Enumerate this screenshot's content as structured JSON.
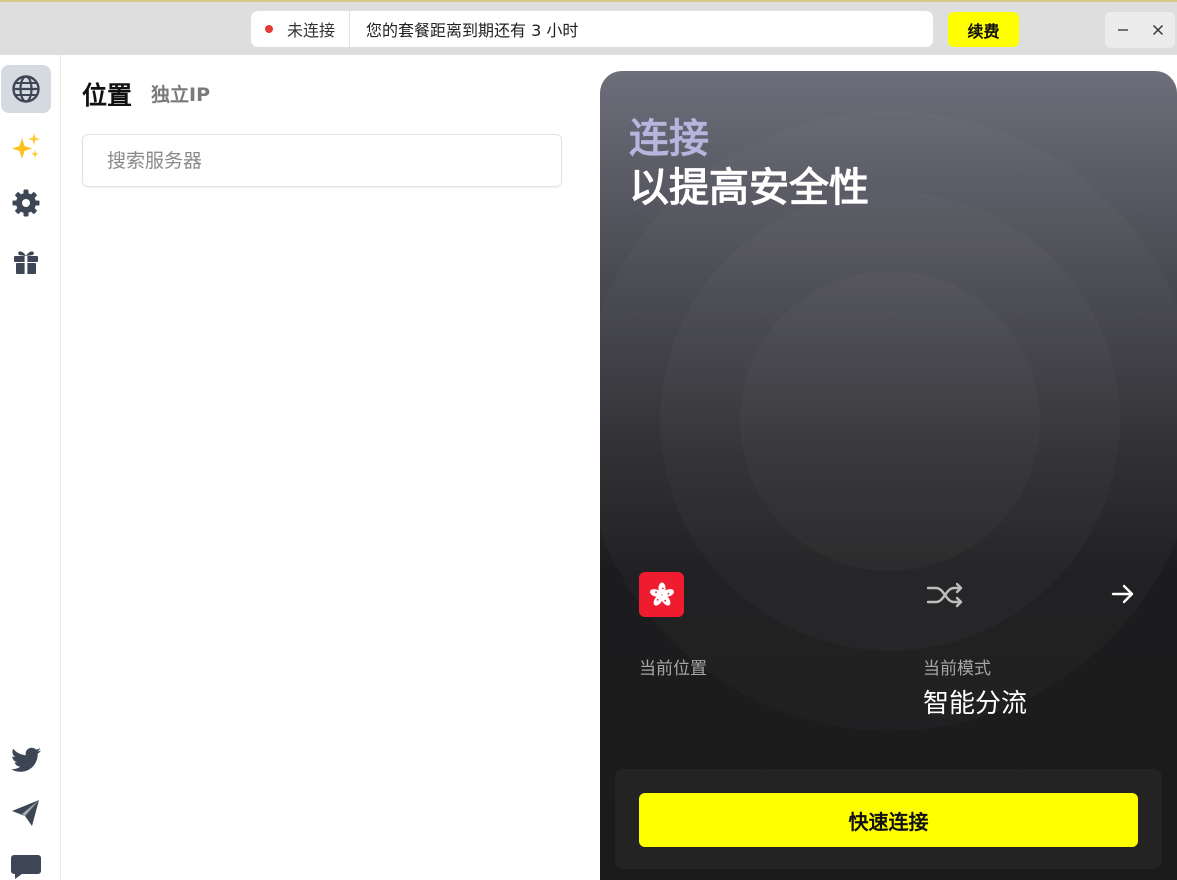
{
  "topbar": {
    "status_text": "未连接",
    "expiry_text": "您的套餐距离到期还有 3 小时",
    "renew_label": "续费",
    "status_color": "#e53935",
    "accent_color": "#ffff00",
    "minimize_symbol": "—",
    "close_symbol": "✕"
  },
  "sidebar": {
    "items": [
      {
        "icon": "globe-icon",
        "active": true
      },
      {
        "icon": "sparkles-icon",
        "active": false
      },
      {
        "icon": "gear-icon",
        "active": false
      },
      {
        "icon": "gift-icon",
        "active": false
      }
    ],
    "bottom_items": [
      {
        "icon": "twitter-icon"
      },
      {
        "icon": "telegram-icon"
      },
      {
        "icon": "chat-icon"
      }
    ]
  },
  "locations": {
    "title": "位置",
    "tab_dedicated_ip": "独立IP",
    "search_placeholder": "搜索服务器"
  },
  "connect_card": {
    "headline_line1": "连接",
    "headline_line2": "以提高安全性",
    "current_location_flag": "hong-kong-flag-icon",
    "current_location_label": "当前位置",
    "current_mode_label": "当前模式",
    "current_mode_value": "智能分流",
    "quick_connect_label": "快速连接"
  }
}
